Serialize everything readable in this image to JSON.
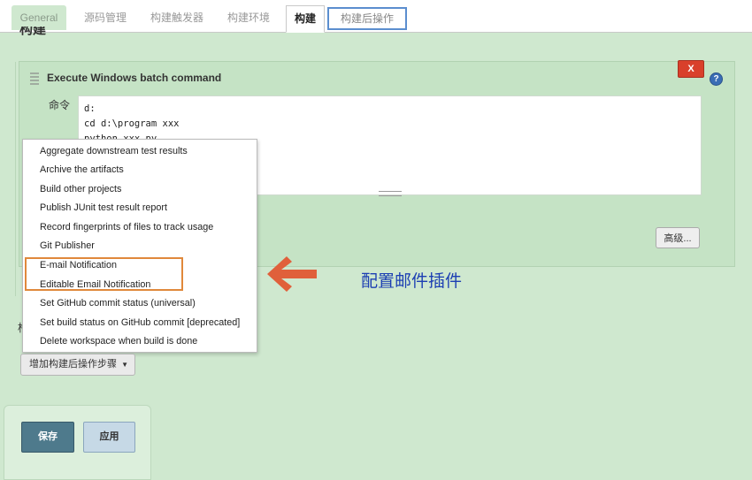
{
  "tabs": [
    {
      "label": "General"
    },
    {
      "label": "源码管理"
    },
    {
      "label": "构建触发器"
    },
    {
      "label": "构建环境"
    },
    {
      "label": "构建"
    },
    {
      "label": "构建后操作"
    }
  ],
  "section_title": "构建",
  "build_step": {
    "title": "Execute Windows batch command",
    "delete_label": "X",
    "help_label": "?",
    "command_label": "命令",
    "command_lines": [
      "d:",
      "cd d:\\program xxx",
      "python xxx.py"
    ],
    "advanced_label": "高级..."
  },
  "menu": {
    "items": [
      "Aggregate downstream test results",
      "Archive the artifacts",
      "Build other projects",
      "Publish JUnit test result report",
      "Record fingerprints of files to track usage",
      "Git Publisher",
      "E-mail Notification",
      "Editable Email Notification",
      "Set GitHub commit status (universal)",
      "Set build status on GitHub commit [deprecated]",
      "Delete workspace when build is done"
    ]
  },
  "annotation": {
    "text": "配置邮件插件",
    "color": "#1d3fb3",
    "arrow_color": "#e0603b"
  },
  "post_build": {
    "hidden_label": "构",
    "add_step_label": "增加构建后操作步骤"
  },
  "footer": {
    "save_label": "保存",
    "apply_label": "应用"
  }
}
